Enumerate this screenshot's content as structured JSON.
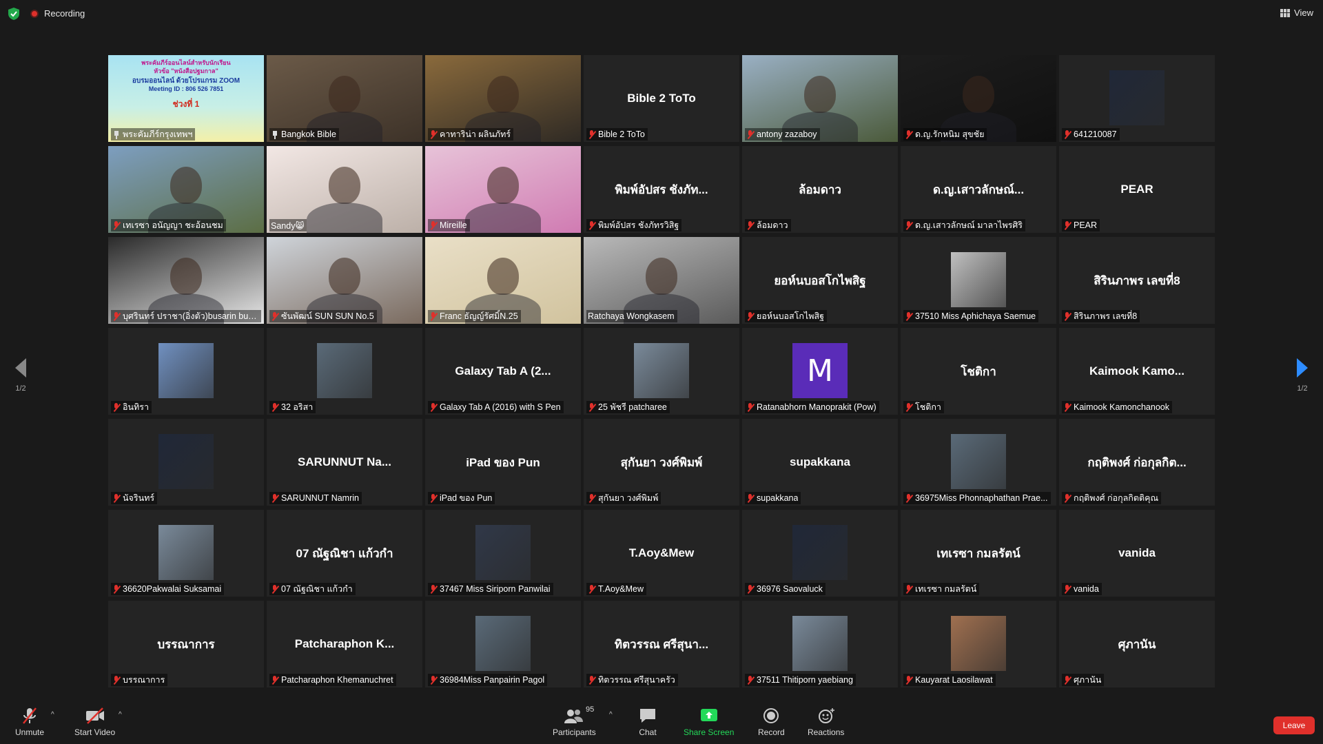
{
  "top_bar": {
    "recording_label": "Recording",
    "view_label": "View"
  },
  "navigation": {
    "left_page": "1/2",
    "right_page": "1/2"
  },
  "tiles": [
    {
      "name": "",
      "label": "พระคัมภีร์กรุงเทพฯ",
      "kind": "poster",
      "icon": "pin-icon"
    },
    {
      "name": "",
      "label": "Bangkok Bible",
      "kind": "video",
      "icon": "pin-icon",
      "active": true
    },
    {
      "name": "",
      "label": "คาทาริน่า ผลินภัทร์",
      "kind": "video",
      "icon": "mic-muted-icon"
    },
    {
      "name": "Bible 2 ToTo",
      "label": "Bible 2 ToTo",
      "kind": "name",
      "icon": "mic-muted-icon"
    },
    {
      "name": "",
      "label": "antony zazaboy",
      "kind": "video",
      "icon": "mic-muted-icon"
    },
    {
      "name": "",
      "label": "ด.ญ.รักหนิม สุขชัย",
      "kind": "video",
      "icon": "mic-muted-icon"
    },
    {
      "name": "",
      "label": "641210087",
      "kind": "thumb",
      "icon": "mic-muted-icon"
    },
    {
      "name": "",
      "label": "เทเรซา อนัญญา ชะอ้อนชม",
      "kind": "video",
      "icon": "mic-muted-icon"
    },
    {
      "name": "",
      "label": "Sandy😸",
      "kind": "video",
      "icon": "none"
    },
    {
      "name": "",
      "label": "Mireille",
      "kind": "video",
      "icon": "mic-muted-icon"
    },
    {
      "name": "พิมพ์อัปสร ชังภัท...",
      "label": "พิมพ์อัปสร ชังภัทรวิสิฐ",
      "kind": "name",
      "icon": "mic-muted-icon"
    },
    {
      "name": "ล้อมดาว",
      "label": "ล้อมดาว",
      "kind": "name",
      "icon": "mic-muted-icon"
    },
    {
      "name": "ด.ญ.เสาวลักษณ์...",
      "label": "ด.ญ.เสาวลักษณ์ มาลาไพรศิริ",
      "kind": "name",
      "icon": "mic-muted-icon"
    },
    {
      "name": "PEAR",
      "label": "PEAR",
      "kind": "name",
      "icon": "mic-muted-icon"
    },
    {
      "name": "",
      "label": "บุศรินทร์ ปราชา(อิ่งตัว)busarin buakh...",
      "kind": "video",
      "icon": "mic-muted-icon"
    },
    {
      "name": "",
      "label": "ซันพัฒน์ SUN SUN No.5",
      "kind": "video",
      "icon": "mic-muted-icon"
    },
    {
      "name": "",
      "label": "Franc ธัญญ์รัศมิ์N.25",
      "kind": "video",
      "icon": "mic-muted-icon"
    },
    {
      "name": "",
      "label": "Ratchaya Wongkasem",
      "kind": "video",
      "icon": "none"
    },
    {
      "name": "ยอห์นบอสโกไพสิฐ",
      "label": "ยอห์นบอสโกไพสิฐ",
      "kind": "name",
      "icon": "mic-muted-icon"
    },
    {
      "name": "",
      "label": "37510 Miss Aphichaya Saemue",
      "kind": "thumb",
      "icon": "mic-muted-icon"
    },
    {
      "name": "สิรินภาพร เลขที่8",
      "label": "สิรินภาพร เลขที่8",
      "kind": "name",
      "icon": "mic-muted-icon"
    },
    {
      "name": "",
      "label": "อินทิรา",
      "kind": "thumb",
      "icon": "mic-muted-icon"
    },
    {
      "name": "",
      "label": "32 อริสา",
      "kind": "thumb",
      "icon": "mic-muted-icon"
    },
    {
      "name": "Galaxy Tab A (2...",
      "label": "Galaxy Tab A (2016) with S Pen",
      "kind": "name",
      "icon": "mic-muted-icon"
    },
    {
      "name": "",
      "label": "25 พัชรี patcharee",
      "kind": "thumb",
      "icon": "mic-muted-icon"
    },
    {
      "name": "",
      "label": "Ratanabhorn Manoprakit (Pow)",
      "kind": "avatar",
      "avatar_letter": "M",
      "icon": "mic-muted-icon"
    },
    {
      "name": "โชติกา",
      "label": "โชติกา",
      "kind": "name",
      "icon": "mic-muted-icon"
    },
    {
      "name": "Kaimook Kamo...",
      "label": "Kaimook Kamonchanook",
      "kind": "name",
      "icon": "mic-muted-icon"
    },
    {
      "name": "",
      "label": "นัจรินทร์",
      "kind": "thumb",
      "icon": "mic-muted-icon"
    },
    {
      "name": "SARUNNUT Na...",
      "label": "SARUNNUT Namrin",
      "kind": "name",
      "icon": "mic-muted-icon"
    },
    {
      "name": "iPad ของ Pun",
      "label": "iPad ของ Pun",
      "kind": "name",
      "icon": "mic-muted-icon"
    },
    {
      "name": "สุกันยา วงศ์พิมพ์",
      "label": "สุกันยา วงศ์พิมพ์",
      "kind": "name",
      "icon": "mic-muted-icon"
    },
    {
      "name": "supakkana",
      "label": "supakkana",
      "kind": "name",
      "icon": "mic-muted-icon"
    },
    {
      "name": "",
      "label": "36975Miss Phonnaphathan Prae...",
      "kind": "thumb",
      "icon": "mic-muted-icon"
    },
    {
      "name": "กฤติพงศ์ ก่อกุลกิต...",
      "label": "กฤติพงศ์ ก่อกุลกิตติคุณ",
      "kind": "name",
      "icon": "mic-muted-icon"
    },
    {
      "name": "",
      "label": "36620Pakwalai Suksamai",
      "kind": "thumb",
      "icon": "mic-muted-icon"
    },
    {
      "name": "07 ณัฐณิชา แก้วกำ",
      "label": "07 ณัฐณิชา แก้วกำ",
      "kind": "name",
      "icon": "mic-muted-icon"
    },
    {
      "name": "",
      "label": "37467 Miss Siriporn Panwilai",
      "kind": "thumb",
      "icon": "mic-muted-icon"
    },
    {
      "name": "T.Aoy&Mew",
      "label": "T.Aoy&Mew",
      "kind": "name",
      "icon": "mic-muted-icon"
    },
    {
      "name": "",
      "label": "36976 Saovaluck",
      "kind": "thumb",
      "icon": "mic-muted-icon"
    },
    {
      "name": "เทเรซา กมลรัตน์",
      "label": "เทเรซา กมลรัตน์",
      "kind": "name",
      "icon": "mic-muted-icon"
    },
    {
      "name": "vanida",
      "label": "vanida",
      "kind": "name",
      "icon": "mic-muted-icon"
    },
    {
      "name": "บรรณาการ",
      "label": "บรรณาการ",
      "kind": "name",
      "icon": "mic-muted-icon"
    },
    {
      "name": "Patcharaphon K...",
      "label": "Patcharaphon Khemanuchret",
      "kind": "name",
      "icon": "mic-muted-icon"
    },
    {
      "name": "",
      "label": "36984Miss Panpairin Pagol",
      "kind": "thumb",
      "icon": "mic-muted-icon"
    },
    {
      "name": "ทิตวรรณ ศรีสุนา...",
      "label": "ทิตวรรณ ศรีสุนาครัว",
      "kind": "name",
      "icon": "mic-muted-icon"
    },
    {
      "name": "",
      "label": "37511 Thitiporn yaebiang",
      "kind": "thumb",
      "icon": "mic-muted-icon"
    },
    {
      "name": "",
      "label": "Kauyarat Laosilawat",
      "kind": "thumb",
      "icon": "mic-muted-icon"
    },
    {
      "name": "ศุภานัน",
      "label": "ศุภานัน",
      "kind": "name",
      "icon": "mic-muted-icon"
    }
  ],
  "poster": {
    "line1": "พระคัมภีร์ออนไลน์สำหรับนักเรียน",
    "line2": "หัวข้อ \"หนังสือปฐมกาล\"",
    "line3": "อบรมออนไลน์ ด้วยโปรแกรม ZOOM",
    "line4": "Meeting ID : 806 526 7851",
    "line5": "ช่วงที่ 1"
  },
  "toolbar": {
    "unmute_label": "Unmute",
    "start_video_label": "Start Video",
    "participants_label": "Participants",
    "participants_count": "95",
    "chat_label": "Chat",
    "share_screen_label": "Share Screen",
    "record_label": "Record",
    "reactions_label": "Reactions",
    "leave_label": "Leave"
  },
  "colors": {
    "share_green": "#23d959",
    "leave_red": "#e0302b",
    "active_speaker": "#d8d33a",
    "avatar_purple": "#5a2cb8",
    "nav_blue": "#2d8cff"
  }
}
